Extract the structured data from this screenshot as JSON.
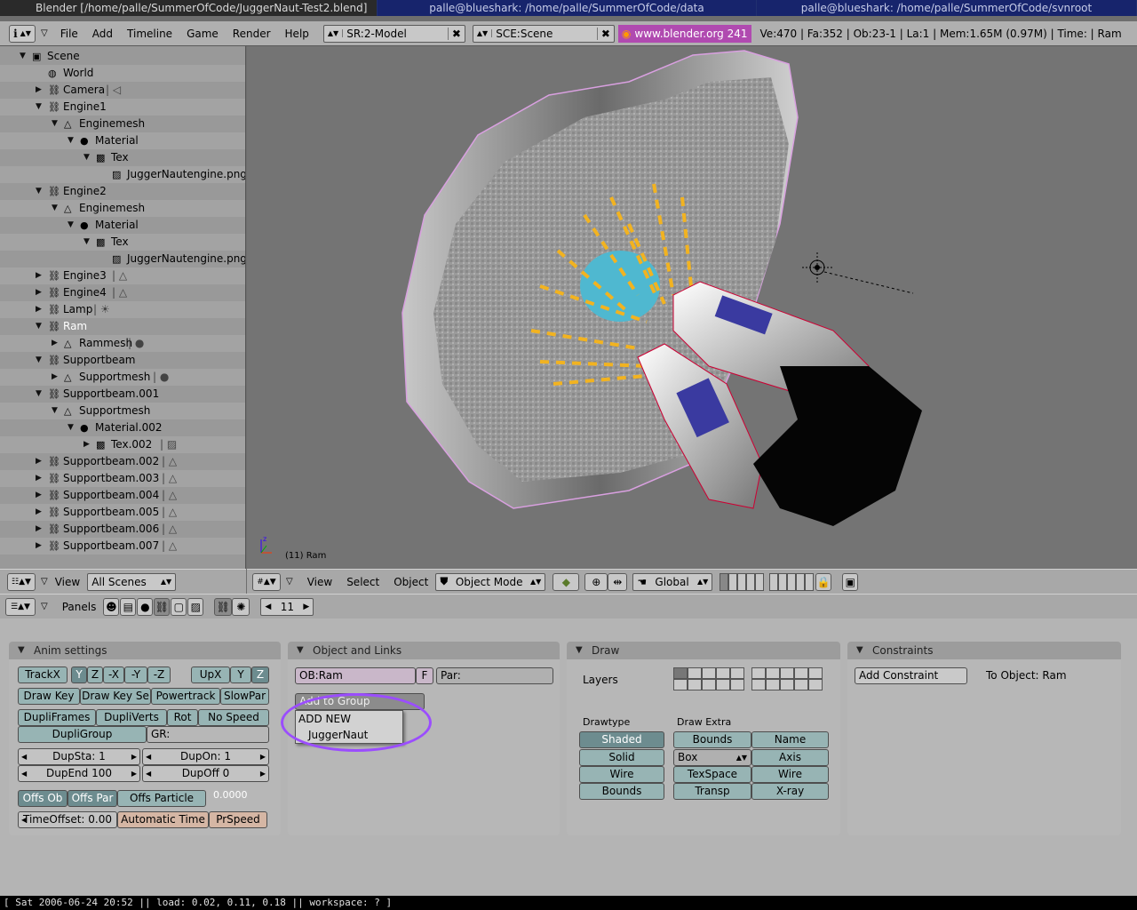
{
  "window_titles": [
    "Blender [/home/palle/SummerOfCode/JuggerNaut-Test2.blend]",
    "palle@blueshark: /home/palle/SummerOfCode/data",
    "palle@blueshark: /home/palle/SummerOfCode/svnroot"
  ],
  "menu": [
    "File",
    "Add",
    "Timeline",
    "Game",
    "Render",
    "Help"
  ],
  "screen_field": "SR:2-Model",
  "scene_field": "SCE:Scene",
  "blender_link": "www.blender.org 241",
  "stats": "Ve:470 | Fa:352 | Ob:23-1 | La:1  | Mem:1.65M (0.97M)  | Time: | Ram",
  "outliner": [
    {
      "label": "Scene",
      "indent": 0,
      "open": true,
      "icon": "scene-icon"
    },
    {
      "label": "World",
      "indent": 1,
      "open": null,
      "icon": "world-icon"
    },
    {
      "label": "Camera",
      "indent": 1,
      "open": false,
      "icon": "object-icon",
      "suffix": "camera-icon"
    },
    {
      "label": "Engine1",
      "indent": 1,
      "open": true,
      "icon": "object-icon"
    },
    {
      "label": "Enginemesh",
      "indent": 2,
      "open": true,
      "icon": "mesh-icon"
    },
    {
      "label": "Material",
      "indent": 3,
      "open": true,
      "icon": "material-icon"
    },
    {
      "label": "Tex",
      "indent": 4,
      "open": true,
      "icon": "texture-icon"
    },
    {
      "label": "JuggerNautengine.png",
      "indent": 5,
      "open": null,
      "icon": "image-icon"
    },
    {
      "label": "Engine2",
      "indent": 1,
      "open": true,
      "icon": "object-icon"
    },
    {
      "label": "Enginemesh",
      "indent": 2,
      "open": true,
      "icon": "mesh-icon"
    },
    {
      "label": "Material",
      "indent": 3,
      "open": true,
      "icon": "material-icon"
    },
    {
      "label": "Tex",
      "indent": 4,
      "open": true,
      "icon": "texture-icon"
    },
    {
      "label": "JuggerNautengine.png",
      "indent": 5,
      "open": null,
      "icon": "image-icon"
    },
    {
      "label": "Engine3",
      "indent": 1,
      "open": false,
      "icon": "object-icon",
      "suffix": "mesh-icon"
    },
    {
      "label": "Engine4",
      "indent": 1,
      "open": false,
      "icon": "object-icon",
      "suffix": "mesh-icon"
    },
    {
      "label": "Lamp",
      "indent": 1,
      "open": false,
      "icon": "object-icon",
      "suffix": "lamp-icon"
    },
    {
      "label": "Ram",
      "indent": 1,
      "open": true,
      "icon": "object-icon",
      "selected": true
    },
    {
      "label": "Rammesh",
      "indent": 2,
      "open": false,
      "icon": "mesh-icon",
      "suffix": "material-icon"
    },
    {
      "label": "Supportbeam",
      "indent": 1,
      "open": true,
      "icon": "object-icon"
    },
    {
      "label": "Supportmesh",
      "indent": 2,
      "open": false,
      "icon": "mesh-icon",
      "suffix": "material-icon"
    },
    {
      "label": "Supportbeam.001",
      "indent": 1,
      "open": true,
      "icon": "object-icon"
    },
    {
      "label": "Supportmesh",
      "indent": 2,
      "open": true,
      "icon": "mesh-icon"
    },
    {
      "label": "Material.002",
      "indent": 3,
      "open": true,
      "icon": "material-icon"
    },
    {
      "label": "Tex.002",
      "indent": 4,
      "open": false,
      "icon": "texture-icon",
      "suffix": "image-icon"
    },
    {
      "label": "Supportbeam.002",
      "indent": 1,
      "open": false,
      "icon": "object-icon",
      "suffix": "mesh-icon"
    },
    {
      "label": "Supportbeam.003",
      "indent": 1,
      "open": false,
      "icon": "object-icon",
      "suffix": "mesh-icon"
    },
    {
      "label": "Supportbeam.004",
      "indent": 1,
      "open": false,
      "icon": "object-icon",
      "suffix": "mesh-icon"
    },
    {
      "label": "Supportbeam.005",
      "indent": 1,
      "open": false,
      "icon": "object-icon",
      "suffix": "mesh-icon"
    },
    {
      "label": "Supportbeam.006",
      "indent": 1,
      "open": false,
      "icon": "object-icon",
      "suffix": "mesh-icon"
    },
    {
      "label": "Supportbeam.007",
      "indent": 1,
      "open": false,
      "icon": "object-icon",
      "suffix": "mesh-icon"
    }
  ],
  "outliner_header": {
    "view": "View",
    "scenes": "All Scenes"
  },
  "viewport": {
    "object_label": "(11) Ram"
  },
  "view3d_header": {
    "view": "View",
    "select": "Select",
    "object": "Object",
    "mode": "Object Mode",
    "orientation": "Global"
  },
  "buttons_header": {
    "panels": "Panels",
    "frame": "11"
  },
  "anim_panel": {
    "title": "Anim settings",
    "track": [
      "TrackX",
      "Y",
      "Z",
      "-X",
      "-Y",
      "-Z"
    ],
    "up": [
      "UpX",
      "Y",
      "Z"
    ],
    "row2": [
      "Draw Key",
      "Draw Key Se",
      "Powertrack",
      "SlowPar"
    ],
    "row3": [
      "DupliFrames",
      "DupliVerts",
      "Rot",
      "No Speed"
    ],
    "dupligroup": "DupliGroup",
    "gr": "GR:",
    "dupsta": "DupSta: 1",
    "dupon": "DupOn: 1",
    "dupend": "DupEnd 100",
    "dupoff": "DupOff 0",
    "offs": [
      "Offs Ob",
      "Offs Par",
      "Offs Particle"
    ],
    "offs_value": "0.0000",
    "timeoffset": "TimeOffset: 0.00",
    "autotime": "Automatic Time",
    "prspeed": "PrSpeed"
  },
  "object_panel": {
    "title": "Object and Links",
    "ob": "OB:Ram",
    "f": "F",
    "par": "Par:",
    "add_group": "Add to Group",
    "menu": [
      "ADD NEW",
      "JuggerNaut"
    ]
  },
  "draw_panel": {
    "title": "Draw",
    "layers": "Layers",
    "drawtype_label": "Drawtype",
    "drawextra_label": "Draw Extra",
    "drawtype": [
      "Shaded",
      "Solid",
      "Wire",
      "Bounds"
    ],
    "extra": [
      [
        "Bounds",
        "Name"
      ],
      [
        "Box",
        "Axis"
      ],
      [
        "TexSpace",
        "Wire"
      ],
      [
        "Transp",
        "X-ray"
      ]
    ]
  },
  "constraints_panel": {
    "title": "Constraints",
    "add": "Add Constraint",
    "to_object": "To Object: Ram"
  },
  "statusbar": "[ Sat 2006-06-24 20:52 || load: 0.02, 0.11, 0.18 || workspace: ? ]",
  "colors": {
    "title_active": "#17246c",
    "viewport_bg": "#747474",
    "selection": "#9b4dff"
  }
}
